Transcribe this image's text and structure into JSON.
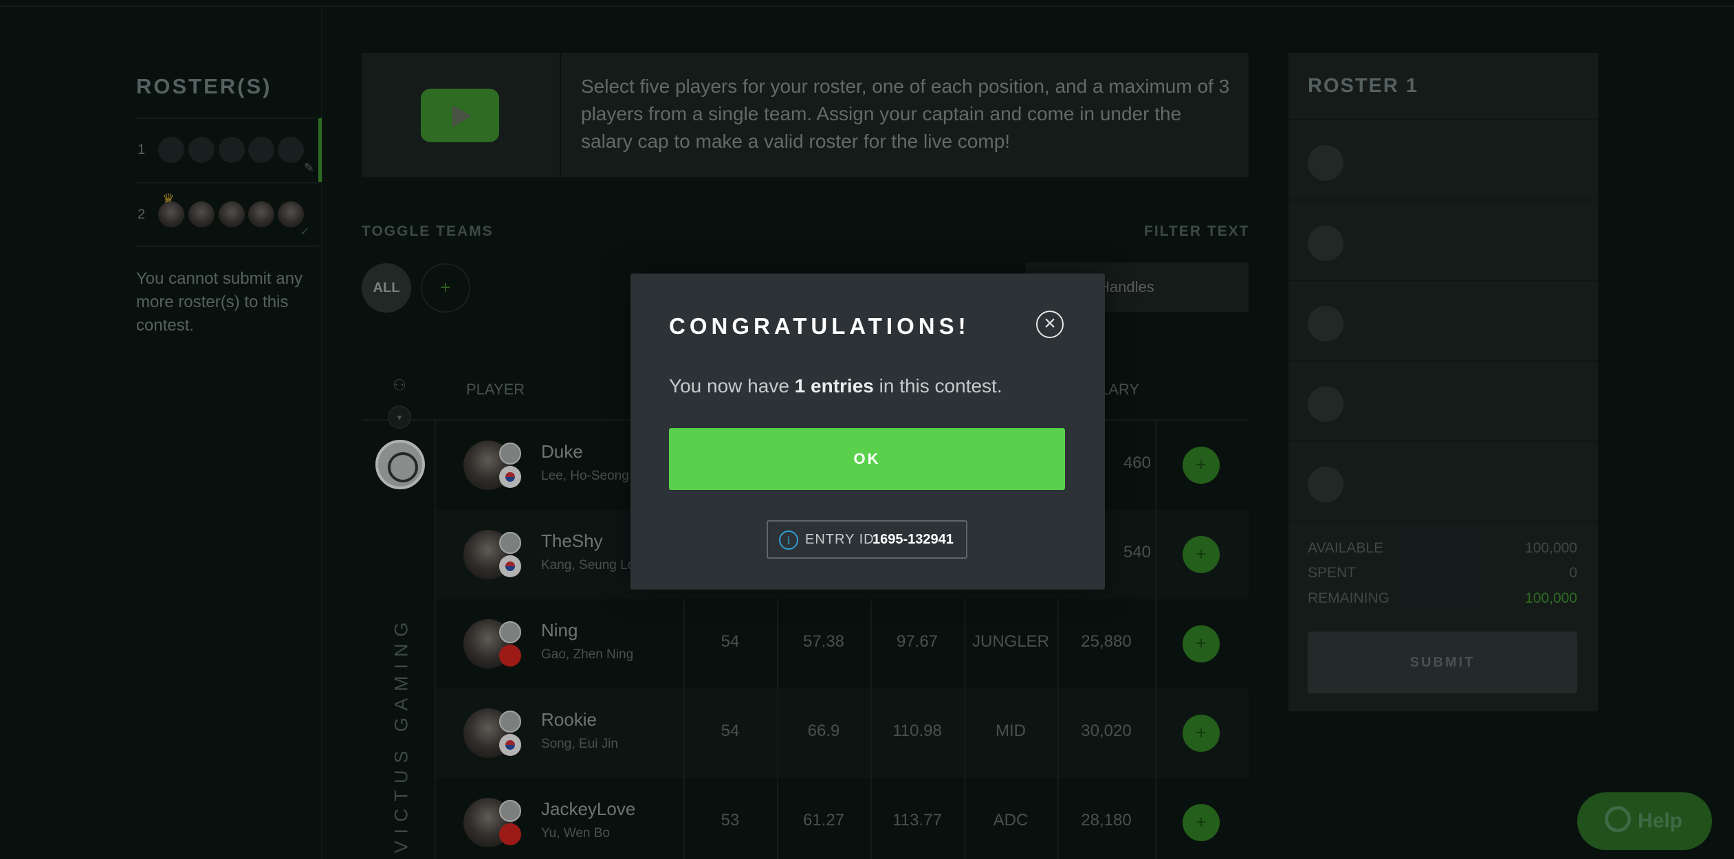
{
  "left": {
    "title": "ROSTER(S)",
    "rosters": [
      {
        "number": "1"
      },
      {
        "number": "2"
      }
    ],
    "message": "You cannot submit any more roster(s) to this contest."
  },
  "info": {
    "text": "Select five players for your roster, one of each position, and a maximum of 3 players from a single team. Assign your captain and come in under the salary cap to make a valid roster for the live comp!"
  },
  "filters": {
    "toggle_label": "TOGGLE TEAMS",
    "filter_label": "FILTER TEXT",
    "all_label": "ALL",
    "add_label": "+",
    "filter_placeholder": "Handles"
  },
  "table": {
    "player_header": "PLAYER",
    "salary_header": "LARY",
    "team_name": "INVICTUS GAMING",
    "players": [
      {
        "name": "Duke",
        "real": "Lee, Ho-Seong",
        "c1": "",
        "c2": "",
        "c3": "",
        "pos": "",
        "salary": "460",
        "flag": "kr"
      },
      {
        "name": "TheShy",
        "real": "Kang, Seung Lo",
        "c1": "",
        "c2": "",
        "c3": "",
        "pos": "",
        "salary": "540",
        "flag": "kr"
      },
      {
        "name": "Ning",
        "real": "Gao, Zhen Ning",
        "c1": "54",
        "c2": "57.38",
        "c3": "97.67",
        "pos": "JUNGLER",
        "salary": "25,880",
        "flag": "cn"
      },
      {
        "name": "Rookie",
        "real": "Song, Eui Jin",
        "c1": "54",
        "c2": "66.9",
        "c3": "110.98",
        "pos": "MID",
        "salary": "30,020",
        "flag": "kr"
      },
      {
        "name": "JackeyLove",
        "real": "Yu, Wen Bo",
        "c1": "53",
        "c2": "61.27",
        "c3": "113.77",
        "pos": "ADC",
        "salary": "28,180",
        "flag": "cn"
      }
    ]
  },
  "right": {
    "title": "ROSTER 1",
    "available_label": "AVAILABLE",
    "available_value": "100,000",
    "spent_label": "SPENT",
    "spent_value": "0",
    "remaining_label": "REMAINING",
    "remaining_value": "100,000",
    "submit_label": "SUBMIT"
  },
  "help_label": "Help",
  "modal": {
    "title": "CONGRATULATIONS!",
    "msg_prefix": "You now have ",
    "msg_bold": "1 entries",
    "msg_suffix": " in this contest.",
    "ok_label": "OK",
    "entry_label": "ENTRY ID",
    "entry_value": "1695-132941"
  },
  "colors": {
    "accent_green": "#5ad14c",
    "dark_green": "#2f7a23",
    "info_blue": "#2e9fd6"
  }
}
